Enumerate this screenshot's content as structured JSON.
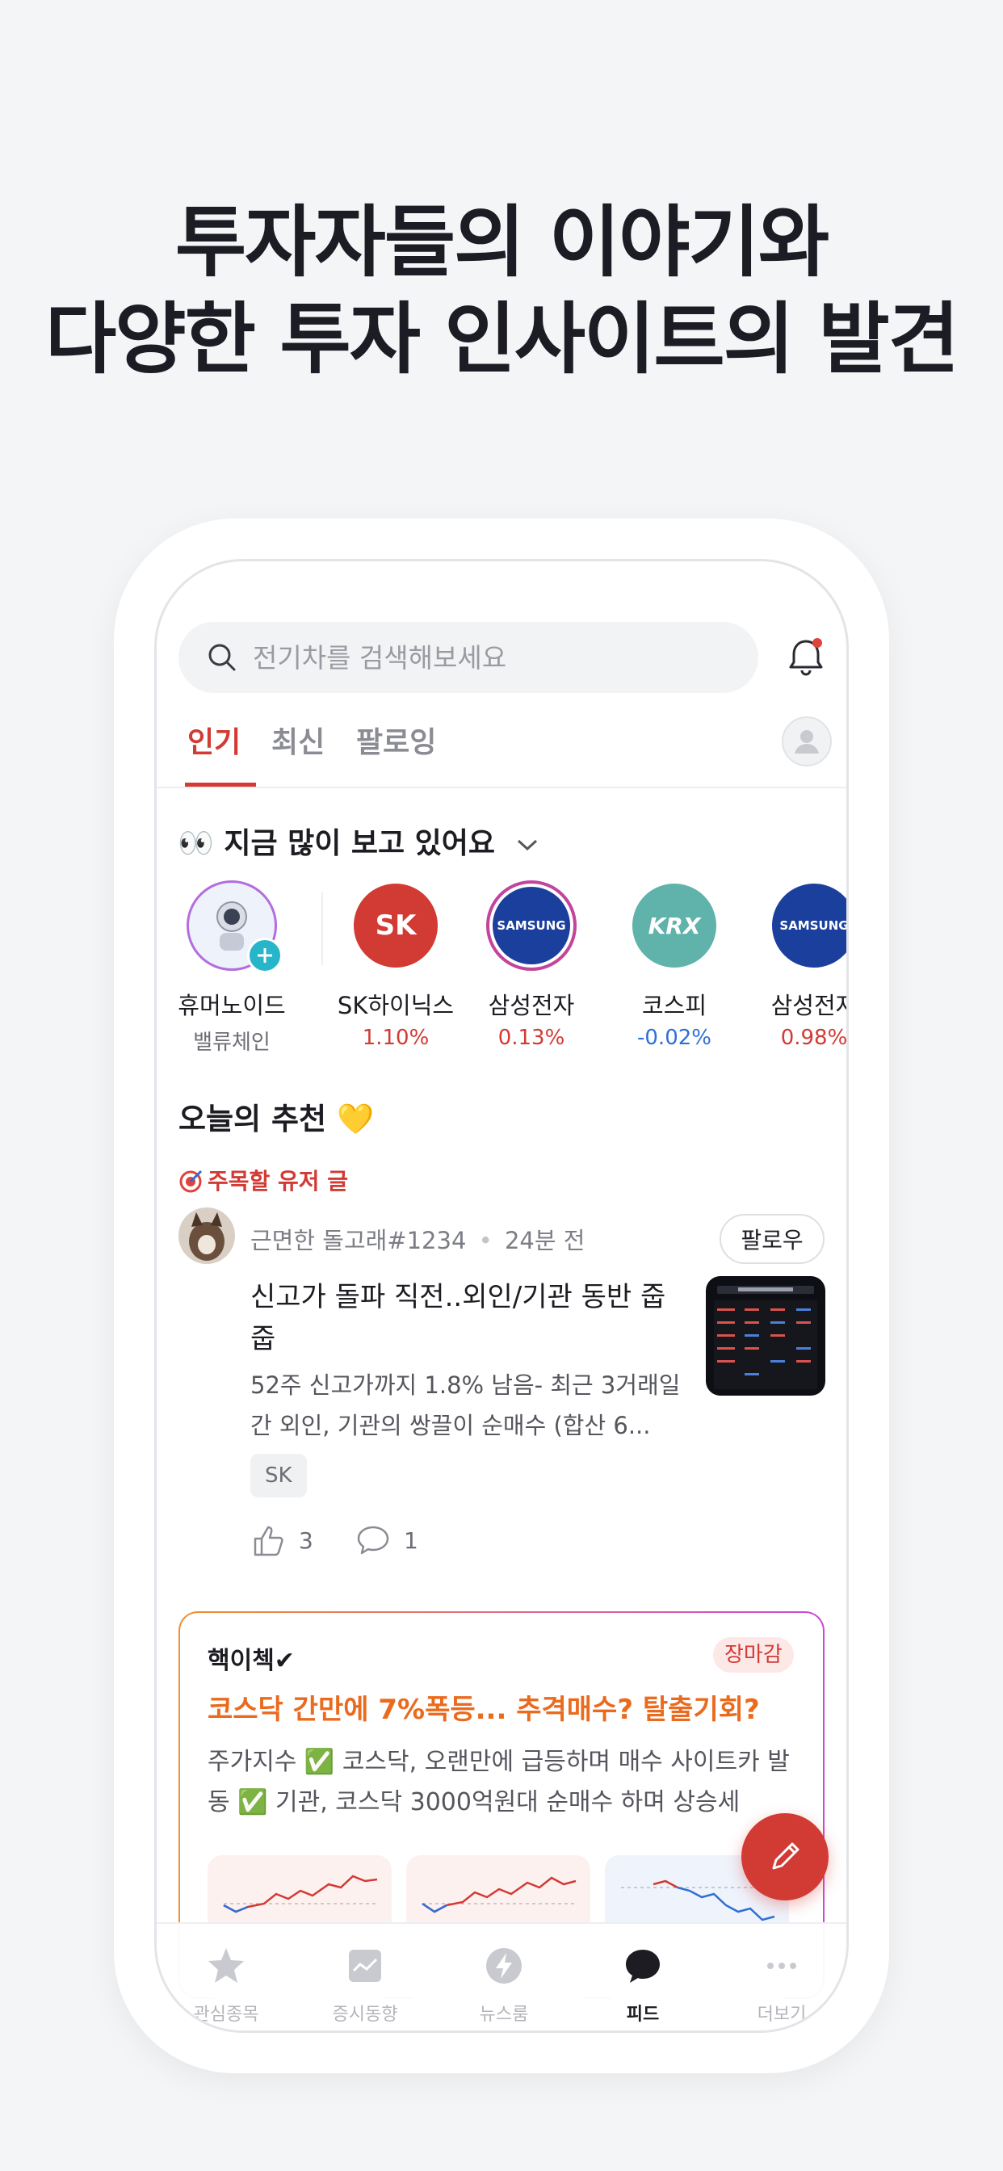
{
  "headline": {
    "line1": "투자자들의 이야기와",
    "line2": "다양한 투자 인사이트의 발견"
  },
  "search": {
    "placeholder": "전기차를 검색해보세요"
  },
  "tabs": [
    {
      "label": "인기",
      "active": true
    },
    {
      "label": "최신",
      "active": false
    },
    {
      "label": "팔로잉",
      "active": false
    }
  ],
  "trending": {
    "title": "👀 지금 많이 보고 있어요",
    "items": [
      {
        "name": "휴머노이드",
        "sub": "밸류체인",
        "logo": "humanoid-robot"
      },
      {
        "name": "SK하이닉스",
        "change": "1.10%",
        "direction": "up",
        "logo_text": "SK",
        "color": "#d23a34"
      },
      {
        "name": "삼성전자",
        "change": "0.13%",
        "direction": "up",
        "logo_text": "SAMSUNG",
        "color": "#1b3f9c"
      },
      {
        "name": "코스피",
        "change": "-0.02%",
        "direction": "down",
        "logo_text": "KRX",
        "color": "#5fb3aa"
      },
      {
        "name": "삼성전자",
        "change": "0.98%",
        "direction": "up",
        "logo_text": "SAMSUNG",
        "color": "#1b3f9c"
      }
    ]
  },
  "recommend": {
    "title": "오늘의 추천 💛",
    "tag": "주목할 유저 글",
    "post": {
      "author": "근면한 돌고래#1234",
      "time": "24분 전",
      "follow_label": "팔로우",
      "title": "신고가 돌파 직전..외인/기관 동반 줍줍",
      "body": "52주 신고가까지 1.8% 남음- 최근 3거래일 간 외인, 기관의 쌍끌이 순매수 (합산 6...",
      "chip": "SK",
      "likes": "3",
      "comments": "1"
    }
  },
  "card": {
    "author": "핵이첵✔",
    "badge": "장마감",
    "title": "코스닥 간만에 7%폭등... 추격매수? 탈출기회?",
    "body": "주가지수 ✅ 코스닥, 오랜만에 급등하며 매수 사이트카 발동 ✅ 기관, 코스닥 3000억원대 순매수 하며 상승세"
  },
  "bottom_nav": [
    {
      "label": "관심종목",
      "icon": "star-icon",
      "active": false
    },
    {
      "label": "증시동향",
      "icon": "chart-icon",
      "active": false
    },
    {
      "label": "뉴스룸",
      "icon": "bolt-icon",
      "active": false
    },
    {
      "label": "피드",
      "icon": "chat-bubble-icon",
      "active": true
    },
    {
      "label": "더보기",
      "icon": "more-icon",
      "active": false
    }
  ],
  "colors": {
    "accent": "#d23a34",
    "down": "#2f6fd6",
    "card_title": "#ea6b1e"
  }
}
